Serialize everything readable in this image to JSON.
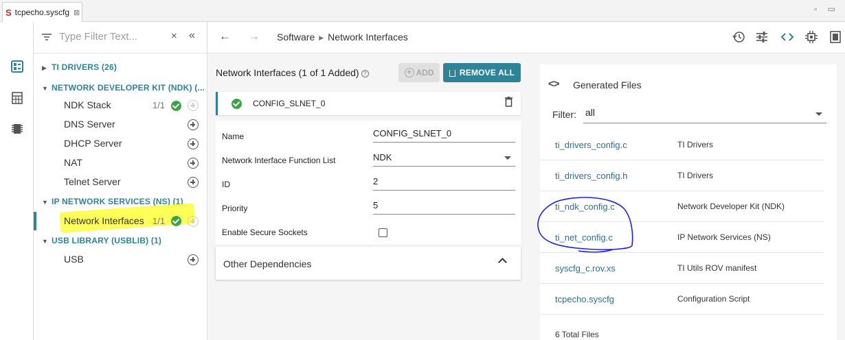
{
  "editor_tab": {
    "icon": "syscfg-logo",
    "filename": "tcpecho.syscfg",
    "close": "⊠"
  },
  "window_controls": "▫ ▭",
  "filter": {
    "placeholder": "Type Filter Text...",
    "clear": "×",
    "collapse": "«"
  },
  "tree": {
    "categories": [
      {
        "label": "TI DRIVERS (26)",
        "expanded": false
      },
      {
        "label": "NETWORK DEVELOPER KIT (NDK) (...",
        "expanded": true
      },
      {
        "label": "IP NETWORK SERVICES (NS) (1)",
        "expanded": true
      },
      {
        "label": "USB LIBRARY (USBLIB) (1)",
        "expanded": true
      }
    ],
    "modules": [
      {
        "label": "NDK Stack",
        "count": "1/1",
        "added": true
      },
      {
        "label": "DNS Server",
        "count": "",
        "added": false
      },
      {
        "label": "DHCP Server",
        "count": "",
        "added": false
      },
      {
        "label": "NAT",
        "count": "",
        "added": false
      },
      {
        "label": "Telnet Server",
        "count": "",
        "added": false
      },
      {
        "label": "Network Interfaces",
        "count": "1/1",
        "added": true,
        "selected": true
      },
      {
        "label": "USB",
        "count": "",
        "added": false
      }
    ]
  },
  "header": {
    "breadcrumb": [
      "Software",
      "Network Interfaces"
    ],
    "back": "←",
    "forward": "→",
    "tools": [
      "history-icon",
      "settings-sliders-icon",
      "code-icon",
      "chip-icon",
      "memory-icon"
    ]
  },
  "module_panel": {
    "title": "Network Interfaces (1 of 1 Added)",
    "help": "?",
    "add_label": "ADD",
    "remove_all_label": "REMOVE ALL",
    "instance": {
      "name": "CONFIG_SLNET_0"
    },
    "fields": [
      {
        "label": "Name",
        "value": "CONFIG_SLNET_0",
        "kind": "text"
      },
      {
        "label": "Network Interface Function List",
        "value": "NDK",
        "kind": "select"
      },
      {
        "label": "ID",
        "value": "2",
        "kind": "text"
      },
      {
        "label": "Priority",
        "value": "5",
        "kind": "text"
      },
      {
        "label": "Enable Secure Sockets",
        "value": "",
        "kind": "checkbox",
        "checked": false
      }
    ],
    "other_dependencies": "Other Dependencies"
  },
  "generated_files": {
    "icon": "<>",
    "title": "Generated Files",
    "filter_label": "Filter:",
    "filter_value": "all",
    "files": [
      {
        "name": "ti_drivers_config.c",
        "desc": "TI Drivers"
      },
      {
        "name": "ti_drivers_config.h",
        "desc": "TI Drivers"
      },
      {
        "name": "ti_ndk_config.c",
        "desc": "Network Developer Kit (NDK)"
      },
      {
        "name": "ti_net_config.c",
        "desc": "IP Network Services (NS)"
      },
      {
        "name": "syscfg_c.rov.xs",
        "desc": "TI Utils ROV manifest"
      },
      {
        "name": "tcpecho.syscfg",
        "desc": "Configuration Script"
      }
    ],
    "total": "6 Total Files"
  },
  "colors": {
    "accent": "#2e8496",
    "ok": "#3aa345",
    "highlighter": "#ffff3a",
    "annotation_pen": "#1e1ef0"
  }
}
